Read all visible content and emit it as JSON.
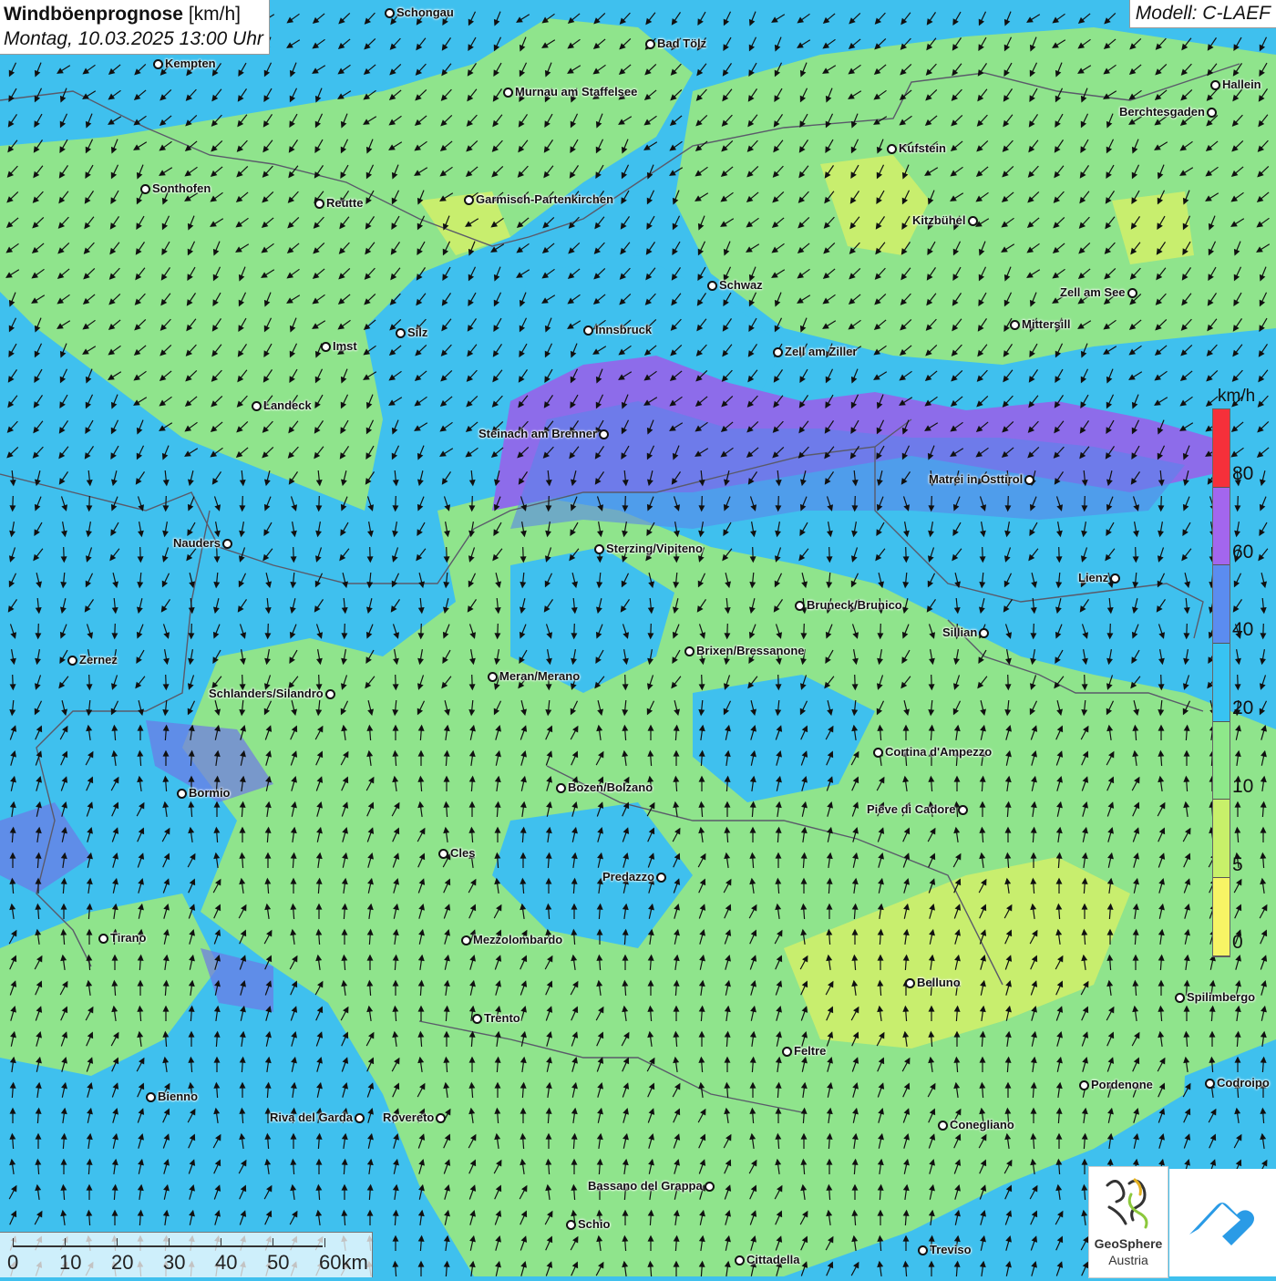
{
  "title": {
    "main": "Windböenprognose",
    "unit": "[km/h]",
    "date": "Montag, 10.03.2025 13:00 Uhr"
  },
  "model": "Modell: C-LAEF",
  "legend": {
    "unit": "km/h",
    "labels": [
      "80",
      "60",
      "40",
      "20",
      "10",
      "5",
      "0"
    ],
    "colors": [
      "#f5303a",
      "#a366ee",
      "#5b8cf0",
      "#38c3f2",
      "#8ee88a",
      "#c8f06a",
      "#f7f465"
    ]
  },
  "scale_bar": {
    "labels": [
      "0",
      "10",
      "20",
      "30",
      "40",
      "50",
      "60km"
    ]
  },
  "logos": {
    "geosphere_line1": "GeoSphere",
    "geosphere_line2": "Austria"
  },
  "cities": [
    {
      "name": "Schongau"
    },
    {
      "name": "Bad Tölz"
    },
    {
      "name": "Kempten"
    },
    {
      "name": "Murnau am Staffelsee"
    },
    {
      "name": "Hallein"
    },
    {
      "name": "Berchtesgaden"
    },
    {
      "name": "Kufstein"
    },
    {
      "name": "Sonthofen"
    },
    {
      "name": "Reutte"
    },
    {
      "name": "Garmisch-Partenkirchen"
    },
    {
      "name": "Kitzbühel"
    },
    {
      "name": "Schwaz"
    },
    {
      "name": "Zell am See"
    },
    {
      "name": "Mittersill"
    },
    {
      "name": "Innsbruck"
    },
    {
      "name": "Silz"
    },
    {
      "name": "Imst"
    },
    {
      "name": "Zell am Ziller"
    },
    {
      "name": "Landeck"
    },
    {
      "name": "Steinach am Brenner"
    },
    {
      "name": "Matrei in Osttirol"
    },
    {
      "name": "Nauders"
    },
    {
      "name": "Sterzing/Vipiteno"
    },
    {
      "name": "Lienz"
    },
    {
      "name": "Bruneck/Brunico"
    },
    {
      "name": "Sillian"
    },
    {
      "name": "Brixen/Bressanone"
    },
    {
      "name": "Zernez"
    },
    {
      "name": "Meran/Merano"
    },
    {
      "name": "Schlanders/Silandro"
    },
    {
      "name": "Cortina d'Ampezzo"
    },
    {
      "name": "Bozen/Bolzano"
    },
    {
      "name": "Bormio"
    },
    {
      "name": "Pieve di Cadore"
    },
    {
      "name": "Cles"
    },
    {
      "name": "Predazzo"
    },
    {
      "name": "Tirano"
    },
    {
      "name": "Mezzolombardo"
    },
    {
      "name": "Belluno"
    },
    {
      "name": "Spilimbergo"
    },
    {
      "name": "Trento"
    },
    {
      "name": "Feltre"
    },
    {
      "name": "Bienno"
    },
    {
      "name": "Pordenone"
    },
    {
      "name": "Codroipo"
    },
    {
      "name": "Riva del Garda"
    },
    {
      "name": "Rovereto"
    },
    {
      "name": "Conegliano"
    },
    {
      "name": "Bassano del Grappa"
    },
    {
      "name": "Schio"
    },
    {
      "name": "Treviso"
    },
    {
      "name": "Cittadella"
    }
  ]
}
